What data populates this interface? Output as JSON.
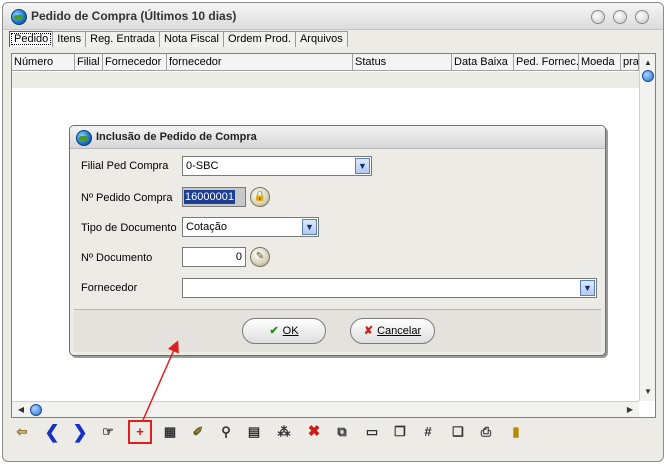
{
  "window": {
    "title": "Pedido de Compra  (Últimos 10 dias)"
  },
  "tabs": [
    "Pedido",
    "Itens",
    "Reg. Entrada",
    "Nota Fiscal",
    "Ordem Prod.",
    "Arquivos"
  ],
  "grid": {
    "columns": [
      "Número",
      "Filial",
      "Fornecedor",
      "fornecedor",
      "Status",
      "Data Baixa",
      "Ped. Fornec.",
      "Moeda",
      "pra"
    ]
  },
  "dialog": {
    "title": "Inclusão de Pedido de Compra",
    "filial_label": "Filial Ped Compra",
    "filial_value": "0-SBC",
    "pedido_label": "Nº Pedido Compra",
    "pedido_value": "16000001",
    "tipo_label": "Tipo de Documento",
    "tipo_value": "Cotação",
    "documento_label": "Nº Documento",
    "documento_value": "0",
    "fornecedor_label": "Fornecedor",
    "fornecedor_value": "",
    "ok_label": "OK",
    "cancel_label": "Cancelar"
  },
  "toolbar": {
    "icons": [
      "exit-icon",
      "back-arrow-icon",
      "forward-arrow-icon",
      "point-icon",
      "new-record-icon",
      "edit-icon",
      "attach-icon",
      "search-icon",
      "filter-icon",
      "tree-icon",
      "delete-icon",
      "copy-icon",
      "card-icon",
      "documents-icon",
      "calculator-icon",
      "note-icon",
      "print-icon",
      "door-icon"
    ],
    "highlighted_icon": "new-record-icon"
  },
  "colors": {
    "annotation": "#e02020",
    "selection": "#1c3f96",
    "arrow_accent": "#5a7fc2"
  }
}
